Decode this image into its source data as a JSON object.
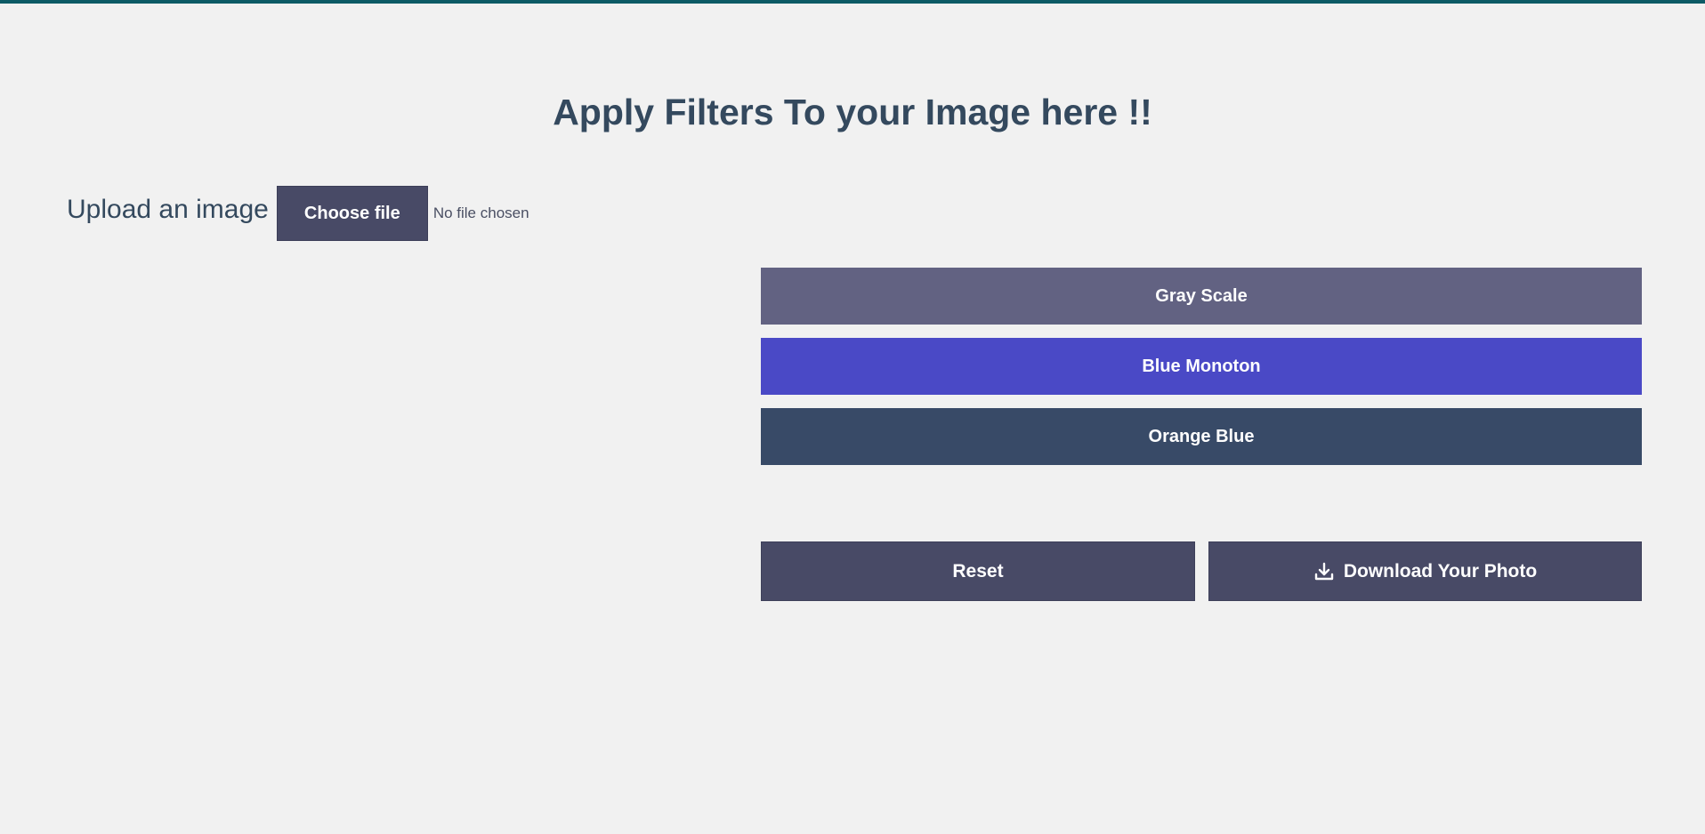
{
  "header": {
    "title": "Apply Filters To your Image here !!"
  },
  "upload": {
    "label": "Upload an image",
    "button_label": "Choose file",
    "status": "No file chosen"
  },
  "filters": {
    "gray_scale": "Gray Scale",
    "blue_monoton": "Blue Monoton",
    "orange_blue": "Orange Blue"
  },
  "actions": {
    "reset_label": "Reset",
    "download_label": "Download Your Photo",
    "download_icon": "download-icon"
  },
  "colors": {
    "accent_bar": "#0d5b66",
    "primary_dark": "#484a66",
    "gray_scale": "#626282",
    "blue_monoton": "#4a49c6",
    "orange_blue": "#384a67",
    "text": "#34495e"
  }
}
